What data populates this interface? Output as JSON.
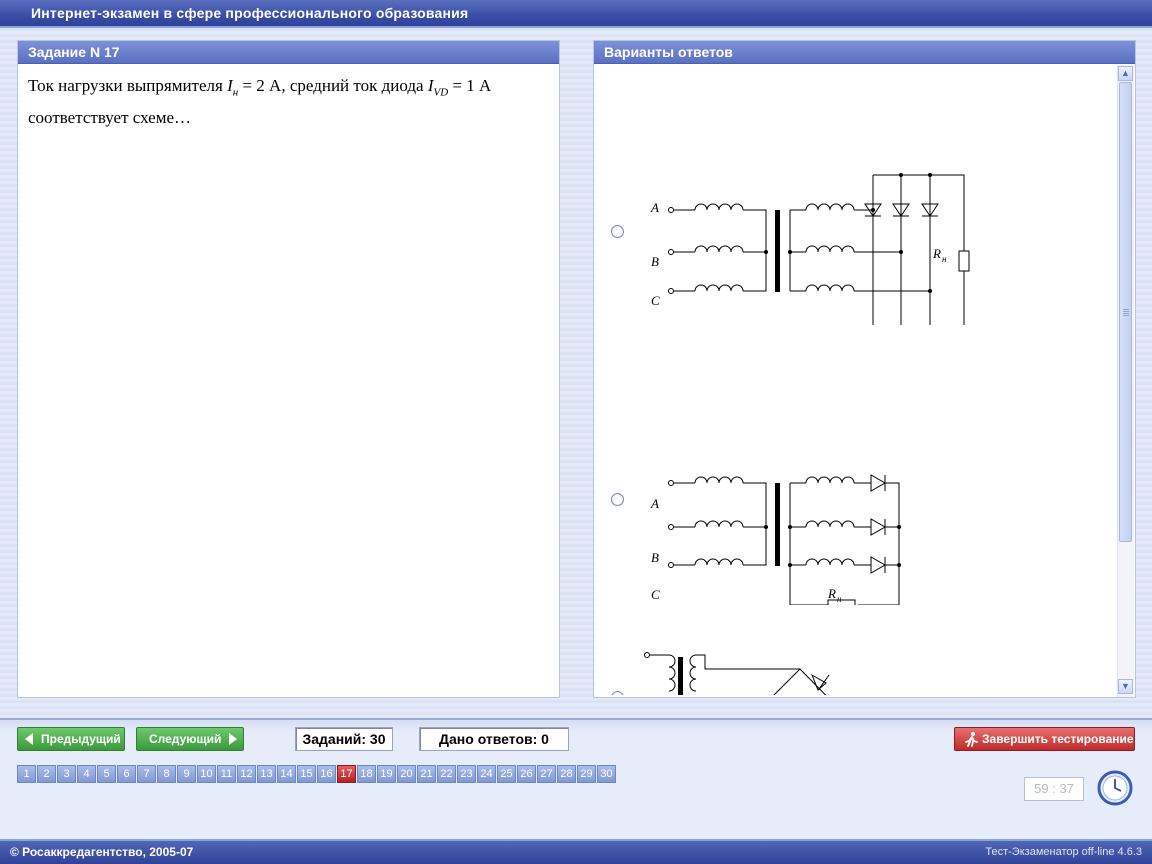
{
  "window": {
    "title": "Интернет-экзамен в сфере профессионального образования"
  },
  "question_panel": {
    "header": "Задание N 17",
    "text_parts": {
      "p1": "Ток нагрузки выпрямителя ",
      "var1": "I",
      "sub1": "н",
      "p2": " = 2 А, средний ток диода ",
      "var2": "I",
      "sub2": "VD",
      "p3": " = 1 А соответствует схеме…"
    }
  },
  "answers_panel": {
    "header": "Варианты ответов",
    "option1": {
      "labels": {
        "a": "A",
        "b": "B",
        "c": "C",
        "r": "R",
        "rsub": "н"
      }
    },
    "option2": {
      "labels": {
        "a": "A",
        "b": "B",
        "c": "C",
        "r": "R",
        "rsub": "н"
      }
    }
  },
  "nav": {
    "prev_label": "Предыдущий",
    "next_label": "Следующий",
    "total_label": "Заданий: 30",
    "answered_label": "Дано ответов: 0",
    "finish_label": "Завершить тестирование"
  },
  "pages": [
    "1",
    "2",
    "3",
    "4",
    "5",
    "6",
    "7",
    "8",
    "9",
    "10",
    "11",
    "12",
    "13",
    "14",
    "15",
    "16",
    "17",
    "18",
    "19",
    "20",
    "21",
    "22",
    "23",
    "24",
    "25",
    "26",
    "27",
    "28",
    "29",
    "30"
  ],
  "current_page": "17",
  "timer": "59 : 37",
  "footer": {
    "copyright": "© Росаккредагентство, 2005-07",
    "version": "Тест-Экзаменатор off-line 4.6.3"
  },
  "colors": {
    "accent": "#4a5fb0",
    "active_page": "#c02b2b",
    "nav_green": "#3a9a3a"
  }
}
